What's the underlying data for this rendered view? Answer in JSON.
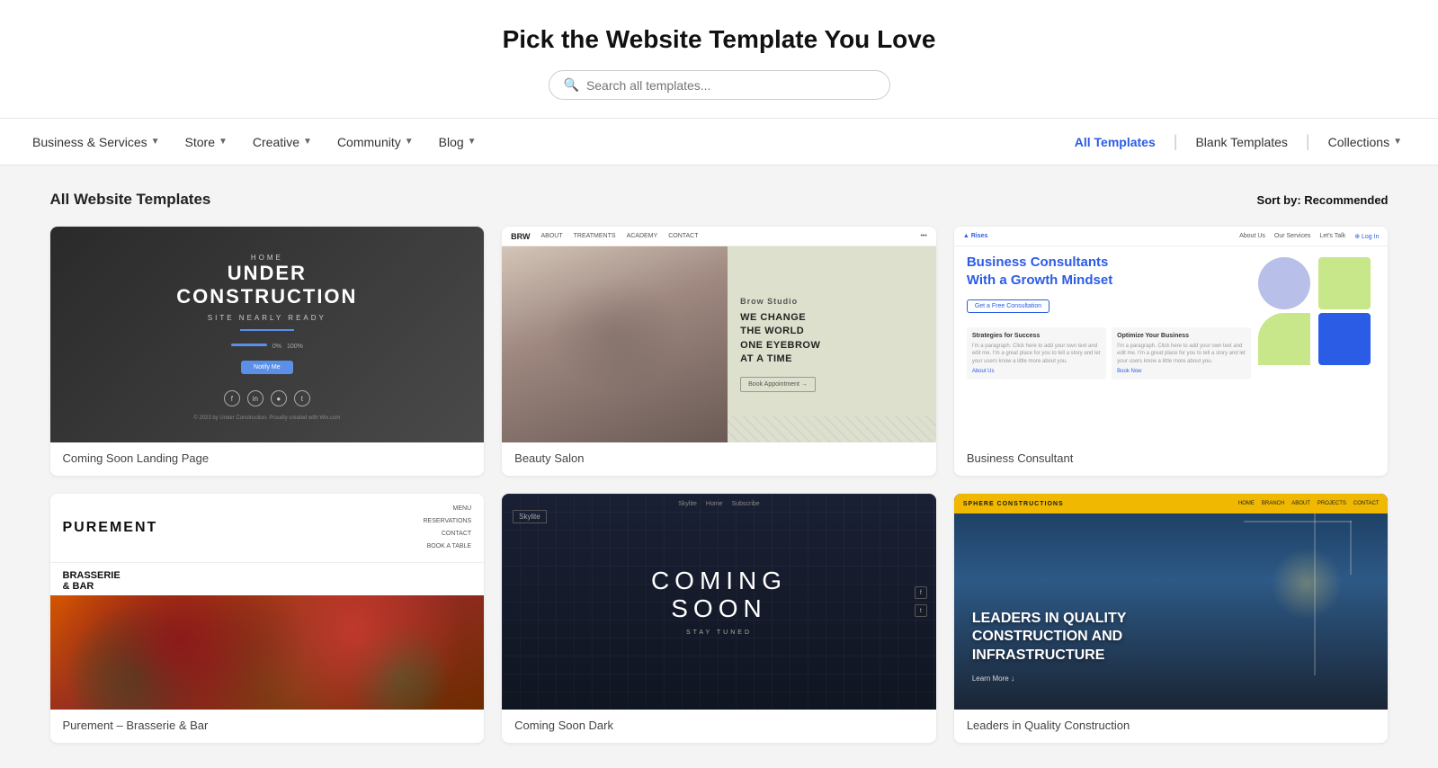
{
  "header": {
    "title": "Pick the Website Template You Love",
    "search_placeholder": "Search all templates..."
  },
  "nav": {
    "left_items": [
      {
        "label": "Business & Services",
        "has_dropdown": true
      },
      {
        "label": "Store",
        "has_dropdown": true
      },
      {
        "label": "Creative",
        "has_dropdown": true
      },
      {
        "label": "Community",
        "has_dropdown": true
      },
      {
        "label": "Blog",
        "has_dropdown": true
      }
    ],
    "right_items": [
      {
        "label": "All Templates",
        "active": true
      },
      {
        "label": "Blank Templates",
        "active": false
      },
      {
        "label": "Collections",
        "has_dropdown": true,
        "active": false
      }
    ]
  },
  "section": {
    "title": "All Website Templates",
    "sort_label": "Sort by:",
    "sort_value": "Recommended"
  },
  "templates": [
    {
      "id": "coming-soon-landing",
      "name": "Coming Soon Landing Page",
      "type": "construction"
    },
    {
      "id": "beauty-salon",
      "name": "Beauty Salon",
      "type": "beauty"
    },
    {
      "id": "business-consultant",
      "name": "Business Consultant",
      "type": "business"
    },
    {
      "id": "restaurant",
      "name": "Purement – Brasserie & Bar",
      "type": "restaurant"
    },
    {
      "id": "coming-soon-dark",
      "name": "Coming Soon Dark",
      "type": "comingsoon"
    },
    {
      "id": "construction-leaders",
      "name": "Leaders in Quality Construction",
      "type": "construct"
    }
  ],
  "thumb_content": {
    "construction": {
      "title": "UNDER\nCONSTRUCTION",
      "subtitle": "SITE NEARLY READY"
    },
    "beauty": {
      "brand": "BRW",
      "tagline": "WE CHANGE\nTHE WORLD\nONE EYEBROW\nAT A TIME"
    },
    "business": {
      "headline": "Business Consultants\nWith a Growth Mindset",
      "btn": "Get a Free Consultation",
      "card1_title": "Strategies for Success",
      "card2_title": "Optimize Your Business"
    },
    "restaurant": {
      "brand": "PUREMENT",
      "subtitle": "BRASSERIE\n& BAR"
    },
    "comingsoon": {
      "title": "COMING\nSOON",
      "sub": "STAY TUNED"
    },
    "construct": {
      "brand": "SPHERE\nCONSTRUCTIONS",
      "headline": "LEADERS IN QUALITY\nCONSTRUCTION AND\nINFRASTRUCTURE"
    }
  }
}
